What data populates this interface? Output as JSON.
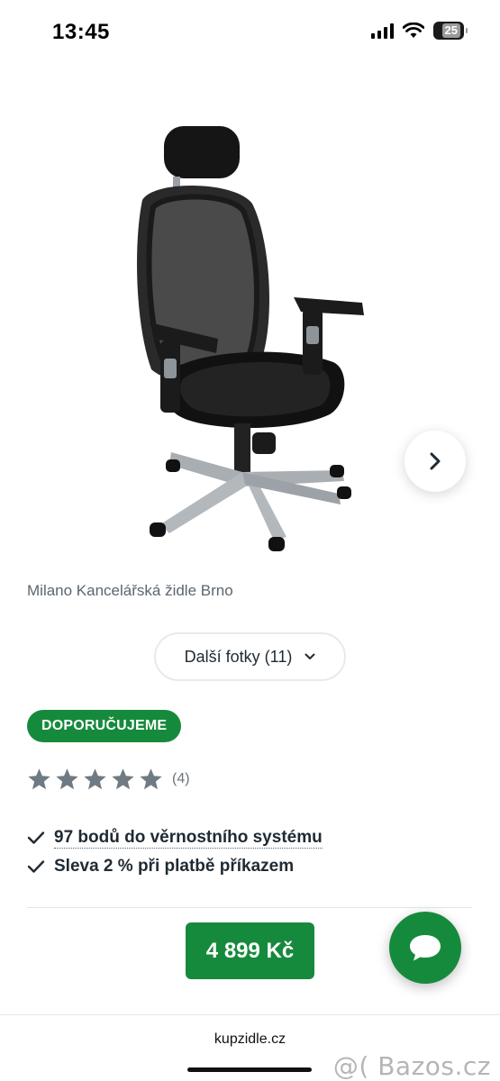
{
  "status_bar": {
    "time": "13:45",
    "battery": "25"
  },
  "gallery": {
    "image_alt": "chair-photo",
    "caption": "Milano Kancelářská židle Brno",
    "more_photos_label": "Další fotky (11)"
  },
  "product": {
    "badge": "DOPORUČUJEME",
    "rating": {
      "stars": 5,
      "count_label": "(4)"
    },
    "benefits": [
      {
        "text": "97 bodů do věrnostního systému"
      },
      {
        "text": "Sleva 2 % při platbě příkazem"
      }
    ],
    "price": "4 899 Kč"
  },
  "browser": {
    "url": "kupzidle.cz"
  },
  "watermark": "@( Bazos.cz",
  "colors": {
    "accent": "#168a3c",
    "star": "#6f7a82"
  },
  "icons": [
    "chevron-right-icon",
    "chevron-down-icon",
    "star-icon",
    "check-icon",
    "chat-icon",
    "signal-icon",
    "wifi-icon",
    "battery-icon"
  ]
}
